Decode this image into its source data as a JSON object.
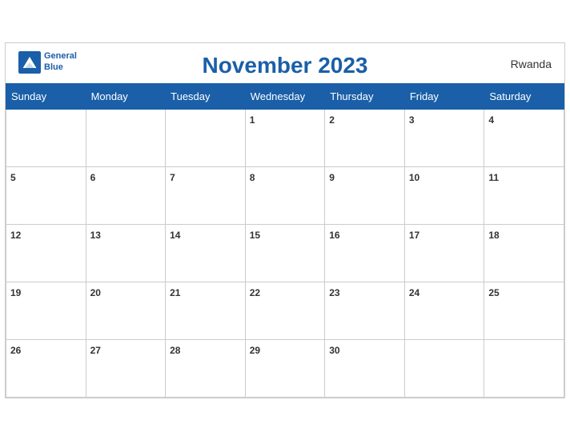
{
  "header": {
    "month_year": "November 2023",
    "country": "Rwanda",
    "logo_line1": "General",
    "logo_line2": "Blue"
  },
  "weekdays": [
    "Sunday",
    "Monday",
    "Tuesday",
    "Wednesday",
    "Thursday",
    "Friday",
    "Saturday"
  ],
  "weeks": [
    [
      null,
      null,
      null,
      1,
      2,
      3,
      4
    ],
    [
      5,
      6,
      7,
      8,
      9,
      10,
      11
    ],
    [
      12,
      13,
      14,
      15,
      16,
      17,
      18
    ],
    [
      19,
      20,
      21,
      22,
      23,
      24,
      25
    ],
    [
      26,
      27,
      28,
      29,
      30,
      null,
      null
    ]
  ]
}
